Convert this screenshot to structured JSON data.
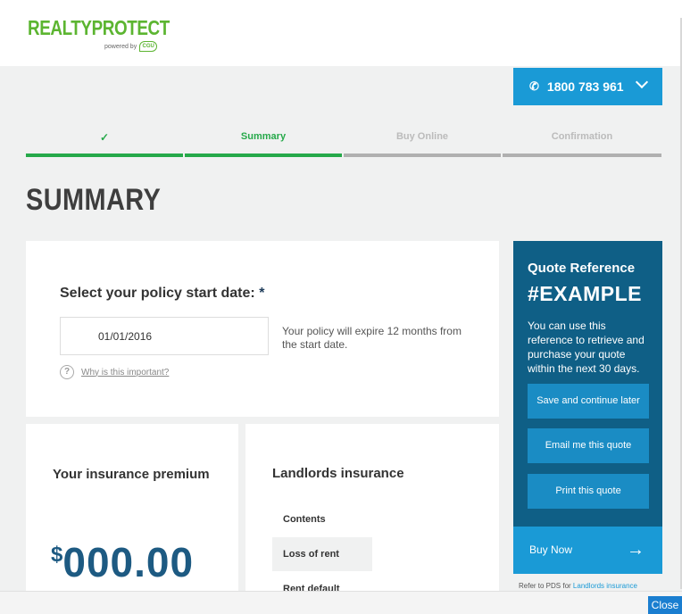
{
  "brand": {
    "name": "REALTYPROTECT",
    "powered_by": "powered by",
    "partner": "CGU"
  },
  "header": {
    "phone": "1800 783 961"
  },
  "steps": [
    {
      "label": "✓",
      "state": "done"
    },
    {
      "label": "Summary",
      "state": "active"
    },
    {
      "label": "Buy Online",
      "state": "upcoming"
    },
    {
      "label": "Confirmation",
      "state": "upcoming"
    }
  ],
  "page_title": "SUMMARY",
  "start_date": {
    "question": "Select your policy start date:",
    "required_marker": "*",
    "value": "01/01/2016",
    "expiry_note": "Your policy will expire 12 months from the start date.",
    "help_link": "Why is this important?"
  },
  "premium": {
    "title": "Your insurance premium",
    "currency": "$",
    "amount": "000.00"
  },
  "cover": {
    "title": "Landlords insurance",
    "items": [
      "Contents",
      "Loss of rent",
      "Rent default"
    ]
  },
  "quote": {
    "heading": "Quote Reference",
    "reference": "#EXAMPLE",
    "description": "You can use this reference to retrieve and purchase your quote within the next 30 days.",
    "save_label": "Save and continue later",
    "email_label": "Email me this quote",
    "print_label": "Print this quote",
    "buy_label": "Buy Now"
  },
  "footer": {
    "pds_prefix": "Refer to PDS for",
    "pds_link": "Landlords insurance",
    "close_label": "Close"
  },
  "colors": {
    "brand_green": "#5cb531",
    "progress_green": "#26a94a",
    "accent_blue": "#1a9ad6",
    "panel_blue": "#0f5f86",
    "price_blue": "#1d5a82"
  }
}
